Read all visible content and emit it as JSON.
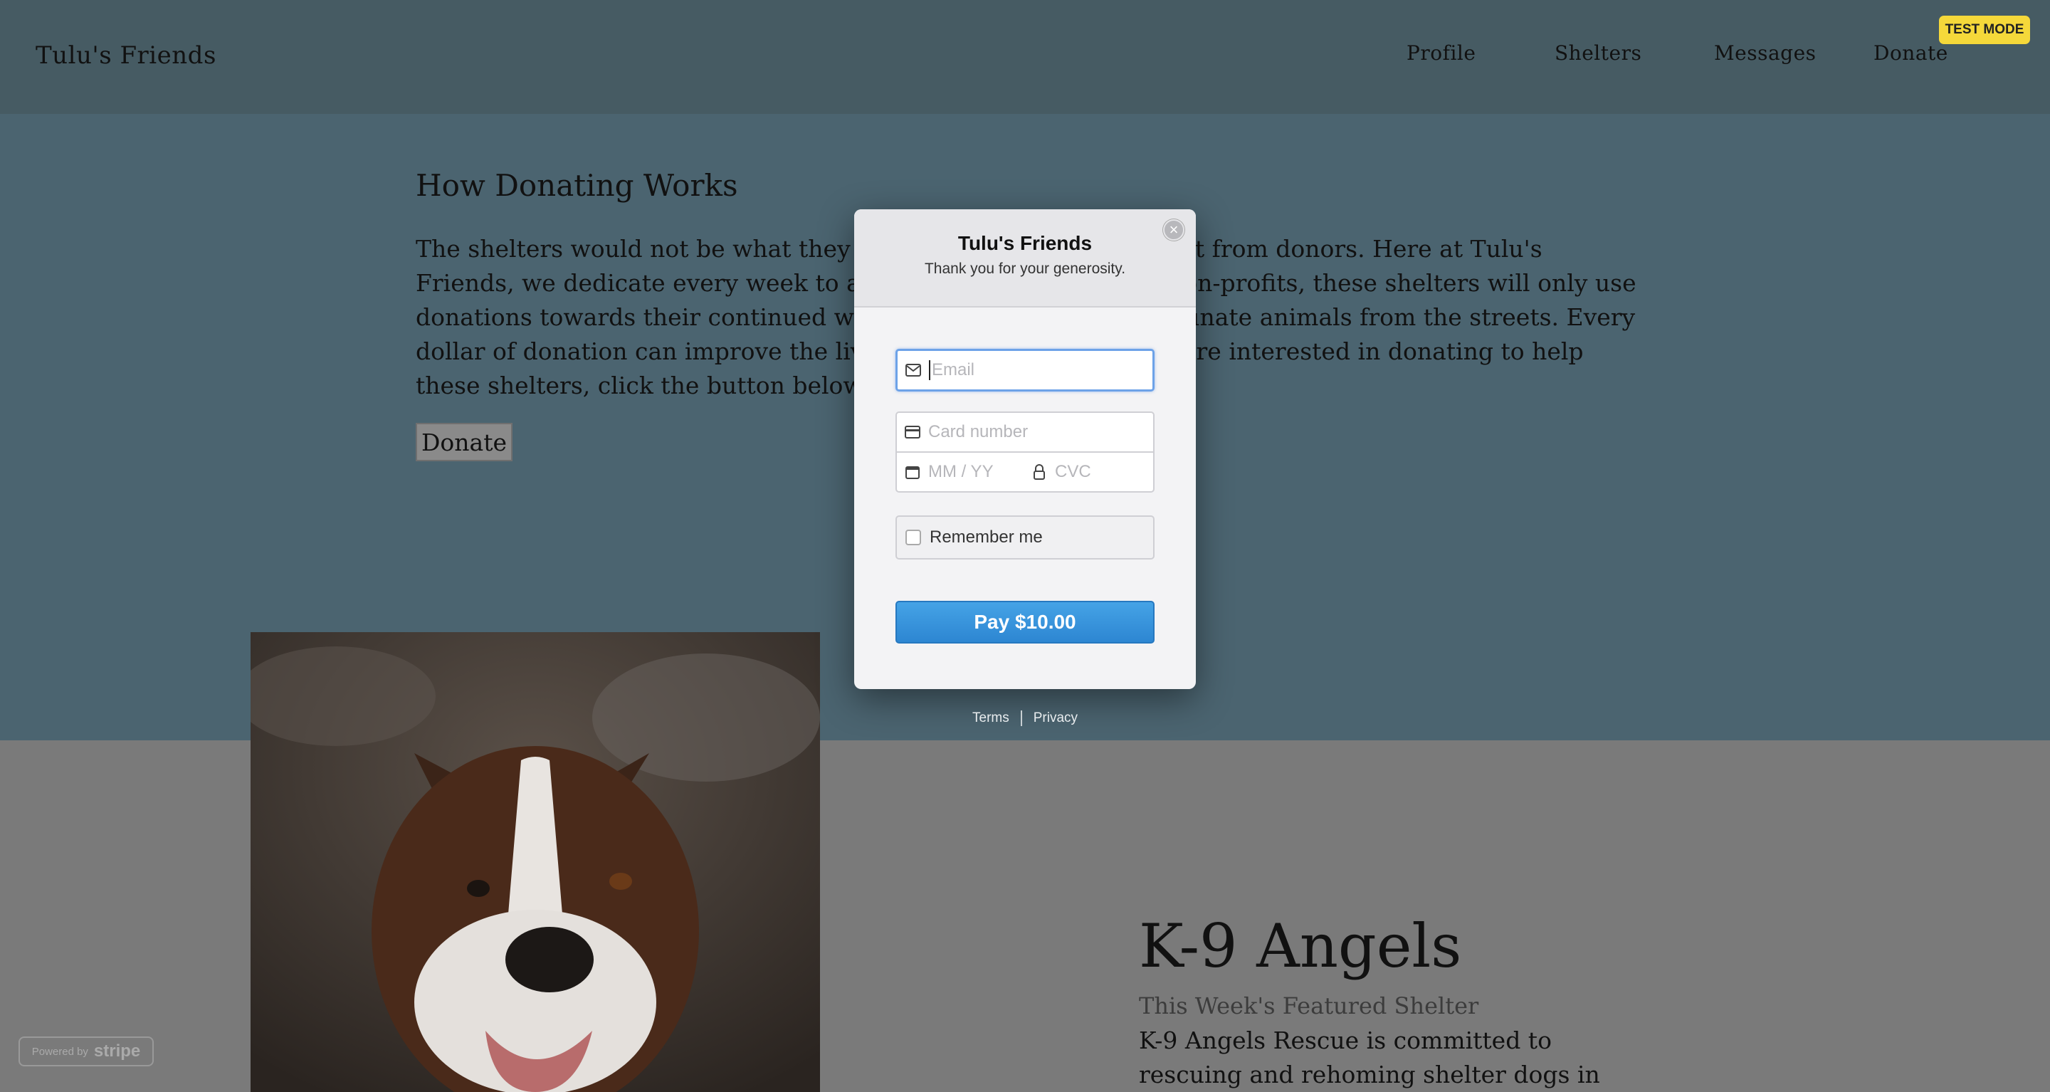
{
  "site": {
    "brand": "Tulu's Friends",
    "nav": [
      "Profile",
      "Shelters",
      "Messages",
      "Donate"
    ],
    "test_mode_badge": "TEST MODE"
  },
  "how_donating": {
    "title": "How Donating Works",
    "body": "The shelters would not be what they are without financial support from donors. Here at Tulu's Friends, we dedicate every week to a shelter for donations. As non-profits, these shelters will only use donations towards their continued work in rescuing more unfortunate animals from the streets. Every dollar of donation can improve the lives of these animals. If you are interested in donating to help these shelters, click the button below.",
    "donate_button": "Donate"
  },
  "featured": {
    "name": "K-9 Angels",
    "subtitle": "This Week's Featured Shelter",
    "description": "K-9 Angels Rescue is committed to rescuing and rehoming shelter dogs in"
  },
  "checkout": {
    "title": "Tulu's Friends",
    "subtitle": "Thank you for your generosity.",
    "email_placeholder": "Email",
    "card_placeholder": "Card number",
    "expiry_placeholder": "MM / YY",
    "cvc_placeholder": "CVC",
    "remember_label": "Remember me",
    "pay_button": "Pay $10.00",
    "links": [
      "Terms",
      "Privacy"
    ],
    "powered_by": "Powered by",
    "stripe_word": "stripe"
  },
  "icons": {
    "email": "envelope-icon",
    "card": "credit-card-icon",
    "expiry": "calendar-icon",
    "cvc": "lock-icon",
    "close": "close-icon"
  },
  "colors": {
    "overlay_top": "#4b6470",
    "overlay_bottom": "#7a7a7a",
    "pay_button": "#3a95dc",
    "test_mode": "#f5d83a",
    "focus_ring": "#6da2e8"
  }
}
